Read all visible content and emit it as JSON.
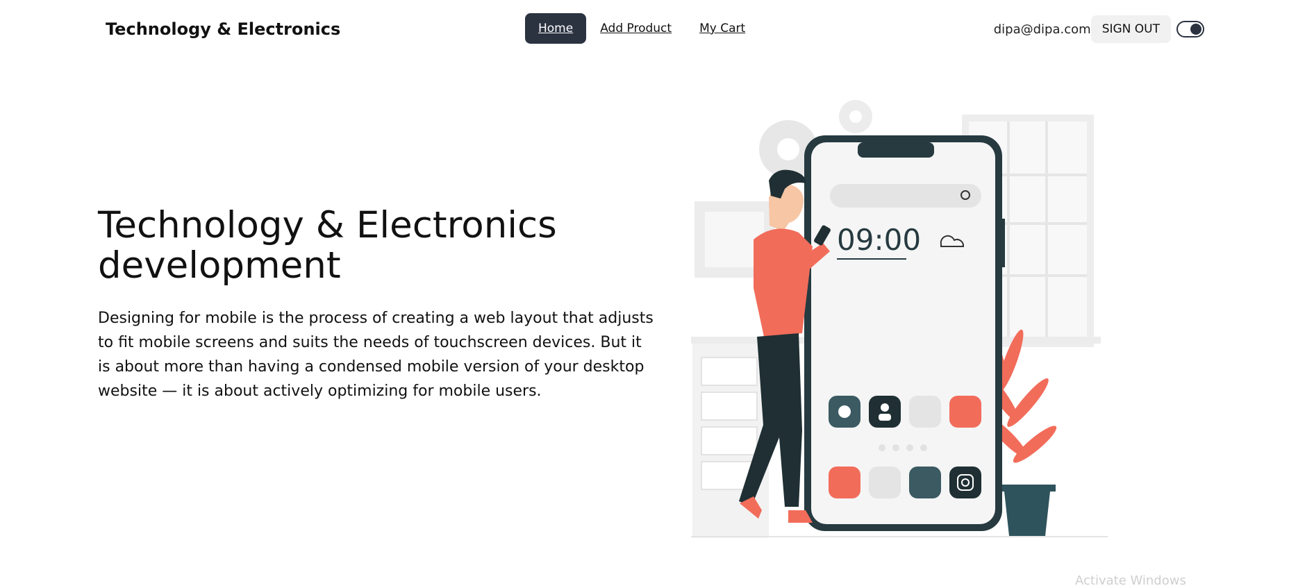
{
  "navbar": {
    "brand": "Technology & Electronics",
    "links": [
      {
        "label": "Home",
        "active": true
      },
      {
        "label": "Add Product",
        "active": false
      },
      {
        "label": "My Cart",
        "active": false
      }
    ],
    "user_email": "dipa@dipa.com",
    "signout_label": "SIGN OUT",
    "theme_toggle_on": true
  },
  "hero": {
    "title": "Technology & Electronics development",
    "description": "Designing for mobile is the process of creating a web layout that adjusts to fit mobile screens and suits the needs of touchscreen devices. But it is about more than having a condensed mobile version of your desktop website — it is about actively optimizing for mobile users.",
    "illustration": {
      "phone_time": "09:00"
    }
  },
  "overlay": {
    "watermark": "Activate Windows"
  },
  "colors": {
    "nav_active_bg": "#2b3240",
    "accent_orange": "#f26c5a",
    "dark_teal": "#263a40"
  }
}
